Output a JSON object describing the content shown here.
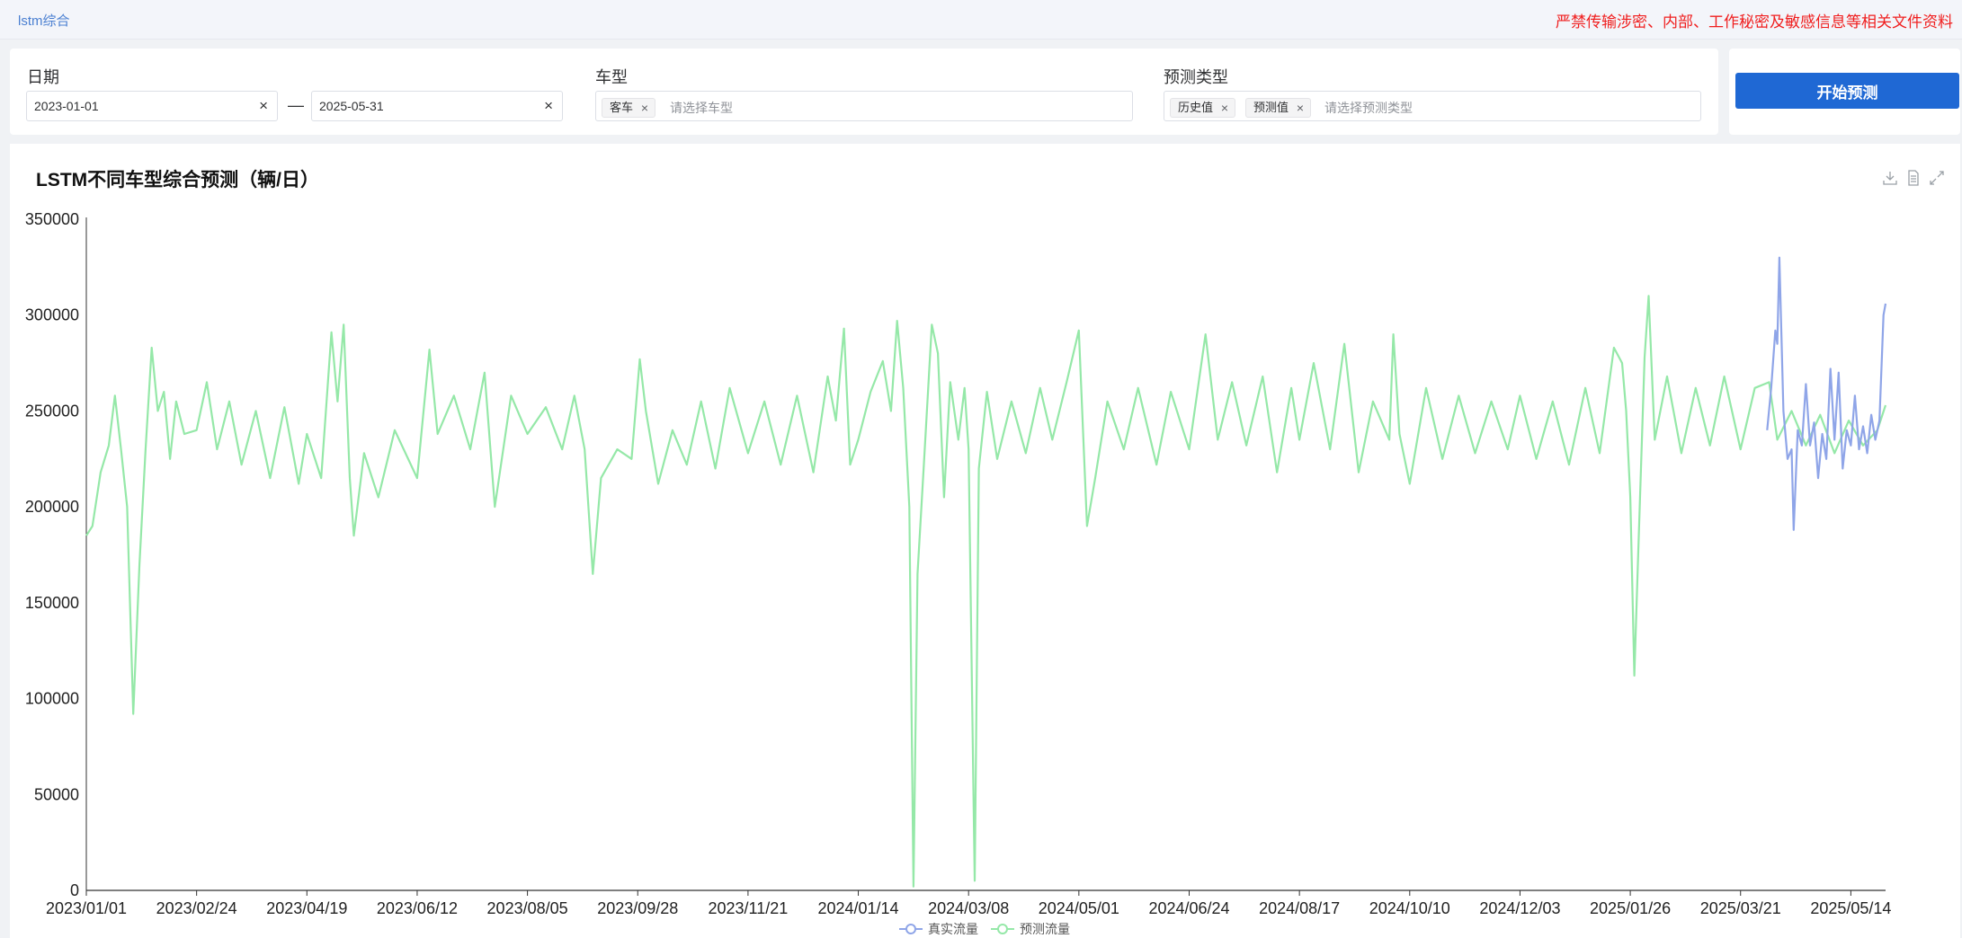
{
  "header": {
    "app_title": "lstm综合",
    "warning": "严禁传输涉密、内部、工作秘密及敏感信息等相关文件资料"
  },
  "filters": {
    "date": {
      "label": "日期",
      "start": "2023-01-01",
      "end": "2025-05-31",
      "separator": "—",
      "clear": "×"
    },
    "vehicle": {
      "label": "车型",
      "tags": [
        "客车"
      ],
      "placeholder": "请选择车型"
    },
    "predict_type": {
      "label": "预测类型",
      "tags": [
        "历史值",
        "预测值"
      ],
      "placeholder": "请选择预测类型"
    },
    "tag_close": "×"
  },
  "actions": {
    "start_predict": "开始预测"
  },
  "toolbox": {
    "icons": [
      "download-icon",
      "data-view-icon",
      "expand-icon"
    ]
  },
  "colors": {
    "real": "#8fa5e8",
    "pred": "#95e8a8",
    "pred_low": "#c4f07a",
    "accent": "#1f68d4",
    "warning": "#f01e1e"
  },
  "chart_data": {
    "type": "line",
    "title": "LSTM不同车型综合预测（辆/日）",
    "ylim": [
      0,
      350000
    ],
    "y_ticks": [
      "0",
      "50000",
      "100000",
      "150000",
      "200000",
      "250000",
      "300000",
      "350000"
    ],
    "x_range": [
      "2023/01/01",
      "2025/05/31"
    ],
    "x_ticks": [
      "2023/01/01",
      "2023/02/24",
      "2023/04/19",
      "2023/06/12",
      "2023/08/05",
      "2023/09/28",
      "2023/11/21",
      "2024/01/14",
      "2024/03/08",
      "2024/05/01",
      "2024/06/24",
      "2024/08/17",
      "2024/10/10",
      "2024/12/03",
      "2025/01/26",
      "2025/03/21",
      "2025/05/14"
    ],
    "legend": [
      "真实流量",
      "预测流量"
    ],
    "legend_position": "bottom-center",
    "series": [
      {
        "name": "预测流量",
        "x_start": "2023/01/01",
        "x_step_days": 1,
        "points": [
          [
            "2023/01/01",
            185000
          ],
          [
            "2023/01/04",
            190000
          ],
          [
            "2023/01/08",
            218000
          ],
          [
            "2023/01/12",
            232000
          ],
          [
            "2023/01/15",
            258000
          ],
          [
            "2023/01/18",
            230000
          ],
          [
            "2023/01/21",
            200000
          ],
          [
            "2023/01/24",
            92000
          ],
          [
            "2023/01/27",
            170000
          ],
          [
            "2023/01/30",
            230000
          ],
          [
            "2023/02/02",
            283000
          ],
          [
            "2023/02/05",
            250000
          ],
          [
            "2023/02/08",
            260000
          ],
          [
            "2023/02/11",
            225000
          ],
          [
            "2023/02/14",
            255000
          ],
          [
            "2023/02/18",
            238000
          ],
          [
            "2023/02/24",
            240000
          ],
          [
            "2023/03/01",
            265000
          ],
          [
            "2023/03/06",
            230000
          ],
          [
            "2023/03/12",
            255000
          ],
          [
            "2023/03/18",
            222000
          ],
          [
            "2023/03/25",
            250000
          ],
          [
            "2023/04/01",
            215000
          ],
          [
            "2023/04/08",
            252000
          ],
          [
            "2023/04/15",
            212000
          ],
          [
            "2023/04/19",
            238000
          ],
          [
            "2023/04/26",
            215000
          ],
          [
            "2023/05/01",
            291000
          ],
          [
            "2023/05/04",
            255000
          ],
          [
            "2023/05/07",
            295000
          ],
          [
            "2023/05/10",
            215000
          ],
          [
            "2023/05/12",
            185000
          ],
          [
            "2023/05/17",
            228000
          ],
          [
            "2023/05/24",
            205000
          ],
          [
            "2023/06/01",
            240000
          ],
          [
            "2023/06/12",
            215000
          ],
          [
            "2023/06/18",
            282000
          ],
          [
            "2023/06/22",
            238000
          ],
          [
            "2023/06/30",
            258000
          ],
          [
            "2023/07/08",
            230000
          ],
          [
            "2023/07/15",
            270000
          ],
          [
            "2023/07/20",
            200000
          ],
          [
            "2023/07/28",
            258000
          ],
          [
            "2023/08/05",
            238000
          ],
          [
            "2023/08/14",
            252000
          ],
          [
            "2023/08/22",
            230000
          ],
          [
            "2023/08/28",
            258000
          ],
          [
            "2023/09/02",
            230000
          ],
          [
            "2023/09/06",
            165000
          ],
          [
            "2023/09/10",
            215000
          ],
          [
            "2023/09/18",
            230000
          ],
          [
            "2023/09/25",
            225000
          ],
          [
            "2023/09/29",
            277000
          ],
          [
            "2023/10/02",
            250000
          ],
          [
            "2023/10/08",
            212000
          ],
          [
            "2023/10/15",
            240000
          ],
          [
            "2023/10/22",
            222000
          ],
          [
            "2023/10/29",
            255000
          ],
          [
            "2023/11/05",
            220000
          ],
          [
            "2023/11/12",
            262000
          ],
          [
            "2023/11/21",
            228000
          ],
          [
            "2023/11/29",
            255000
          ],
          [
            "2023/12/07",
            222000
          ],
          [
            "2023/12/15",
            258000
          ],
          [
            "2023/12/23",
            218000
          ],
          [
            "2023/12/30",
            268000
          ],
          [
            "2024/01/03",
            245000
          ],
          [
            "2024/01/07",
            293000
          ],
          [
            "2024/01/10",
            222000
          ],
          [
            "2024/01/14",
            235000
          ],
          [
            "2024/01/20",
            260000
          ],
          [
            "2024/01/26",
            276000
          ],
          [
            "2024/01/30",
            250000
          ],
          [
            "2024/02/02",
            297000
          ],
          [
            "2024/02/05",
            262000
          ],
          [
            "2024/02/08",
            200000
          ],
          [
            "2024/02/10",
            2000
          ],
          [
            "2024/02/12",
            165000
          ],
          [
            "2024/02/15",
            220000
          ],
          [
            "2024/02/19",
            295000
          ],
          [
            "2024/02/22",
            280000
          ],
          [
            "2024/02/25",
            205000
          ],
          [
            "2024/02/28",
            265000
          ],
          [
            "2024/03/03",
            235000
          ],
          [
            "2024/03/06",
            262000
          ],
          [
            "2024/03/08",
            230000
          ],
          [
            "2024/03/11",
            5000
          ],
          [
            "2024/03/13",
            220000
          ],
          [
            "2024/03/17",
            260000
          ],
          [
            "2024/03/22",
            225000
          ],
          [
            "2024/03/29",
            255000
          ],
          [
            "2024/04/05",
            228000
          ],
          [
            "2024/04/12",
            262000
          ],
          [
            "2024/04/18",
            235000
          ],
          [
            "2024/04/25",
            265000
          ],
          [
            "2024/05/01",
            292000
          ],
          [
            "2024/05/05",
            190000
          ],
          [
            "2024/05/09",
            215000
          ],
          [
            "2024/05/15",
            255000
          ],
          [
            "2024/05/23",
            230000
          ],
          [
            "2024/05/30",
            262000
          ],
          [
            "2024/06/08",
            222000
          ],
          [
            "2024/06/15",
            260000
          ],
          [
            "2024/06/24",
            230000
          ],
          [
            "2024/07/02",
            290000
          ],
          [
            "2024/07/08",
            235000
          ],
          [
            "2024/07/15",
            265000
          ],
          [
            "2024/07/22",
            232000
          ],
          [
            "2024/07/30",
            268000
          ],
          [
            "2024/08/06",
            218000
          ],
          [
            "2024/08/13",
            262000
          ],
          [
            "2024/08/17",
            235000
          ],
          [
            "2024/08/24",
            275000
          ],
          [
            "2024/09/01",
            230000
          ],
          [
            "2024/09/08",
            285000
          ],
          [
            "2024/09/15",
            218000
          ],
          [
            "2024/09/22",
            255000
          ],
          [
            "2024/09/30",
            235000
          ],
          [
            "2024/10/02",
            290000
          ],
          [
            "2024/10/05",
            238000
          ],
          [
            "2024/10/10",
            212000
          ],
          [
            "2024/10/18",
            262000
          ],
          [
            "2024/10/26",
            225000
          ],
          [
            "2024/11/03",
            258000
          ],
          [
            "2024/11/11",
            228000
          ],
          [
            "2024/11/19",
            255000
          ],
          [
            "2024/11/27",
            230000
          ],
          [
            "2024/12/03",
            258000
          ],
          [
            "2024/12/11",
            225000
          ],
          [
            "2024/12/19",
            255000
          ],
          [
            "2024/12/27",
            222000
          ],
          [
            "2025/01/04",
            262000
          ],
          [
            "2025/01/11",
            228000
          ],
          [
            "2025/01/18",
            283000
          ],
          [
            "2025/01/22",
            275000
          ],
          [
            "2025/01/24",
            250000
          ],
          [
            "2025/01/26",
            205000
          ],
          [
            "2025/01/28",
            112000
          ],
          [
            "2025/01/30",
            180000
          ],
          [
            "2025/02/02",
            278000
          ],
          [
            "2025/02/04",
            310000
          ],
          [
            "2025/02/07",
            235000
          ],
          [
            "2025/02/13",
            268000
          ],
          [
            "2025/02/20",
            228000
          ],
          [
            "2025/02/27",
            262000
          ],
          [
            "2025/03/06",
            232000
          ],
          [
            "2025/03/13",
            268000
          ],
          [
            "2025/03/21",
            230000
          ],
          [
            "2025/03/28",
            262000
          ],
          [
            "2025/04/04",
            265000
          ],
          [
            "2025/04/08",
            235000
          ],
          [
            "2025/04/15",
            250000
          ],
          [
            "2025/04/22",
            232000
          ],
          [
            "2025/04/29",
            248000
          ],
          [
            "2025/05/06",
            228000
          ],
          [
            "2025/05/13",
            245000
          ],
          [
            "2025/05/20",
            232000
          ],
          [
            "2025/05/27",
            240000
          ],
          [
            "2025/05/31",
            253000
          ]
        ]
      },
      {
        "name": "真实流量",
        "points": [
          [
            "2025/04/03",
            240000
          ],
          [
            "2025/04/05",
            262000
          ],
          [
            "2025/04/07",
            292000
          ],
          [
            "2025/04/08",
            285000
          ],
          [
            "2025/04/09",
            330000
          ],
          [
            "2025/04/11",
            250000
          ],
          [
            "2025/04/13",
            225000
          ],
          [
            "2025/04/15",
            230000
          ],
          [
            "2025/04/16",
            188000
          ],
          [
            "2025/04/18",
            240000
          ],
          [
            "2025/04/20",
            232000
          ],
          [
            "2025/04/22",
            264000
          ],
          [
            "2025/04/24",
            232000
          ],
          [
            "2025/04/26",
            244000
          ],
          [
            "2025/04/28",
            215000
          ],
          [
            "2025/04/30",
            238000
          ],
          [
            "2025/05/02",
            225000
          ],
          [
            "2025/05/04",
            272000
          ],
          [
            "2025/05/06",
            235000
          ],
          [
            "2025/05/08",
            270000
          ],
          [
            "2025/05/10",
            220000
          ],
          [
            "2025/05/12",
            240000
          ],
          [
            "2025/05/14",
            232000
          ],
          [
            "2025/05/16",
            258000
          ],
          [
            "2025/05/18",
            230000
          ],
          [
            "2025/05/20",
            242000
          ],
          [
            "2025/05/22",
            228000
          ],
          [
            "2025/05/24",
            248000
          ],
          [
            "2025/05/26",
            235000
          ],
          [
            "2025/05/28",
            245000
          ],
          [
            "2025/05/30",
            300000
          ],
          [
            "2025/05/31",
            306000
          ]
        ]
      }
    ]
  }
}
